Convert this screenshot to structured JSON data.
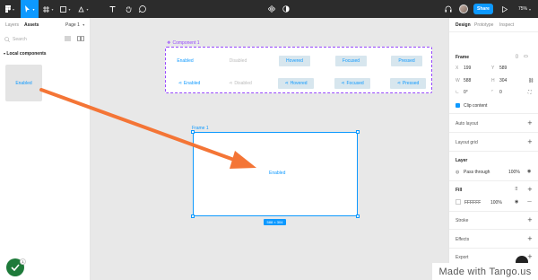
{
  "toolbar": {
    "share_label": "Share",
    "zoom": "75%"
  },
  "left_panel": {
    "tab_layers": "Layers",
    "tab_assets": "Assets",
    "page_selector": "Page 1",
    "search_placeholder": "Search",
    "section_title": "Local components",
    "component_thumbnail_label": "Enabled",
    "checklist_count": "1"
  },
  "canvas": {
    "component_set_label": "Component 1",
    "variants_row1": [
      "Enabled",
      "Disabled",
      "Hovered",
      "Focused",
      "Pressed"
    ],
    "variants_row2": [
      "Enabled",
      "Disabled",
      "Hovered",
      "Focused",
      "Pressed"
    ],
    "frame_label": "Frame 1",
    "frame_text": "Enabled",
    "size_badge": "588 × 304"
  },
  "right_panel": {
    "tab_design": "Design",
    "tab_prototype": "Prototype",
    "tab_inspect": "Inspect",
    "frame_title": "Frame",
    "x_label": "X",
    "x_value": "199",
    "y_label": "Y",
    "y_value": "589",
    "w_label": "W",
    "w_value": "588",
    "h_label": "H",
    "h_value": "304",
    "rotation_value": "0°",
    "radius_value": "0",
    "clip_content": "Clip content",
    "auto_layout": "Auto layout",
    "layout_grid": "Layout grid",
    "layer": "Layer",
    "blend_mode": "Pass through",
    "layer_opacity": "100%",
    "fill": "Fill",
    "fill_hex": "FFFFFF",
    "fill_opacity": "100%",
    "stroke": "Stroke",
    "effects": "Effects",
    "export": "Export"
  },
  "watermark": "Made with Tango.us",
  "colors": {
    "toolbar_bg": "#2c2c2c",
    "accent": "#0d99ff",
    "component_purple": "#9747ff",
    "annotation_arrow": "#f47536",
    "canvas_bg": "#e8e8e8"
  }
}
